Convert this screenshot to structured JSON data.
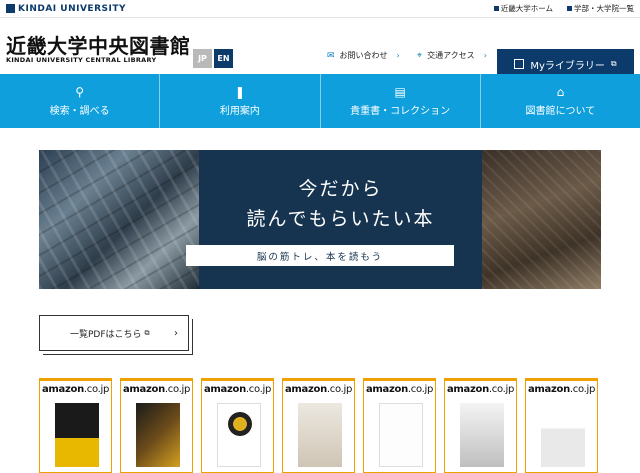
{
  "topbar": {
    "brand": "KINDAI UNIVERSITY",
    "links": [
      "近畿大学ホーム",
      "学部・大学院一覧"
    ]
  },
  "header": {
    "title": "近畿大学中央図書館",
    "subtitle": "KINDAI UNIVERSITY CENTRAL LIBRARY",
    "lang_jp": "JP",
    "lang_en": "EN",
    "contact_label": "お問い合わせ",
    "access_label": "交通アクセス",
    "mylibrary_label": "Myライブラリー"
  },
  "nav": {
    "items": [
      {
        "label": "検索・調べる",
        "icon": "search-icon"
      },
      {
        "label": "利用案内",
        "icon": "book-open-icon"
      },
      {
        "label": "貴重書・コレクション",
        "icon": "books-stack-icon"
      },
      {
        "label": "図書館について",
        "icon": "library-building-icon"
      }
    ]
  },
  "banner": {
    "headline_line1": "今だから",
    "headline_line2": "読んでもらいたい本",
    "tagline": "脳の筋トレ、本を読もう"
  },
  "pdf_button": {
    "label": "一覧PDFはこちら"
  },
  "books": {
    "store_label_main": "amazon",
    "store_label_domain": ".co.jp",
    "count": 7
  },
  "colors": {
    "navy": "#0b3a6b",
    "nav_blue": "#0f9fdc",
    "amazon_orange": "#f0a000"
  }
}
